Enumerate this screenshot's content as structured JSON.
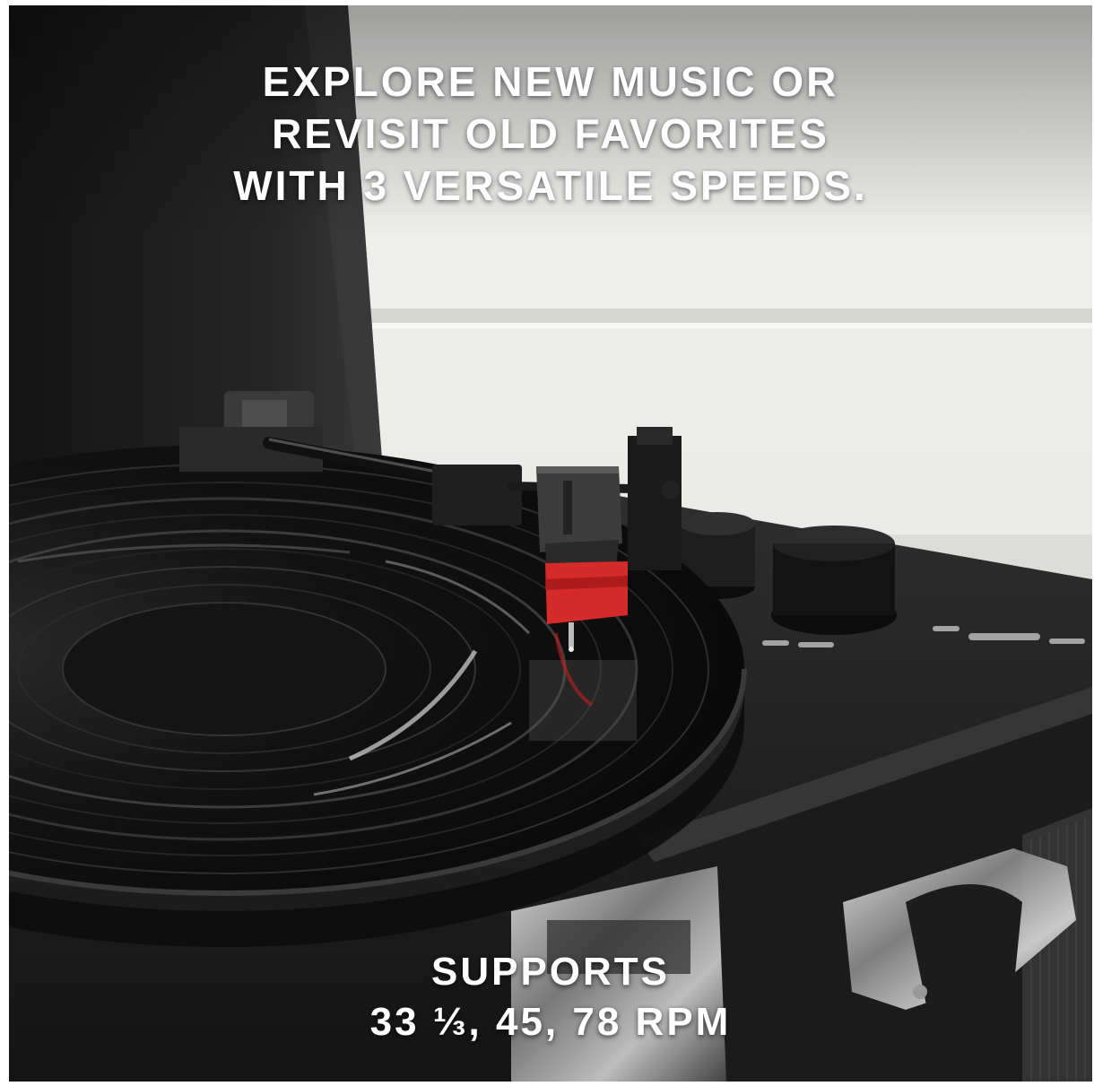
{
  "headline": {
    "line1": "EXPLORE NEW MUSIC OR",
    "line2": "REVISIT OLD FAVORITES",
    "line3": "WITH 3 VERSATILE SPEEDS."
  },
  "caption": {
    "line1": "SUPPORTS",
    "line2": "33 ⅓, 45, 78 RPM"
  },
  "colors": {
    "text": "#ffffff",
    "cartridge_accent": "#d42a2a",
    "record": "#111111",
    "wall": "#e9e9e7"
  },
  "photo": {
    "subject": "turntable-tonearm-cartridge-on-vinyl-record"
  }
}
